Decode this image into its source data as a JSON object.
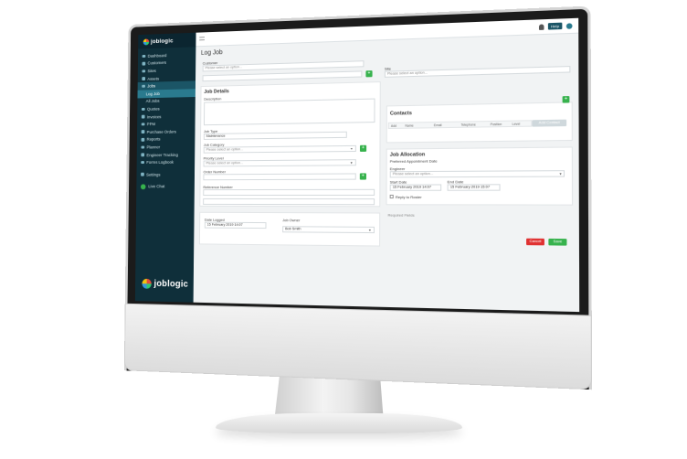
{
  "app": {
    "brand": "joblogic",
    "help_label": "Help"
  },
  "sidebar": {
    "items": [
      {
        "label": "Dashboard"
      },
      {
        "label": "Customers"
      },
      {
        "label": "Sites"
      },
      {
        "label": "Assets"
      },
      {
        "label": "Jobs"
      },
      {
        "label": "Log Job"
      },
      {
        "label": "All Jobs"
      },
      {
        "label": "Quotes"
      },
      {
        "label": "Invoices"
      },
      {
        "label": "PPM"
      },
      {
        "label": "Purchase Orders"
      },
      {
        "label": "Reports"
      },
      {
        "label": "Planner"
      },
      {
        "label": "Engineer Tracking"
      },
      {
        "label": "Forms Logbook"
      },
      {
        "label": "Settings"
      }
    ],
    "live_chat": "Live Chat"
  },
  "page": {
    "title": "Log Job"
  },
  "customer": {
    "label": "Customer",
    "placeholder": "Please select an option..."
  },
  "site": {
    "label": "Site",
    "placeholder": "Please select an option..."
  },
  "job_details": {
    "title": "Job Details",
    "description_label": "Description",
    "job_type_label": "Job Type",
    "job_type_value": "Maintenance",
    "job_category_label": "Job Category",
    "job_category_placeholder": "Please select an option...",
    "priority_label": "Priority Level",
    "priority_placeholder": "Please select an option...",
    "order_number_label": "Order Number",
    "reference_number_label": "Reference Number"
  },
  "contacts": {
    "title": "Contacts",
    "button": "Add Contact",
    "columns": [
      "Add",
      "Name",
      "Email",
      "Telephone",
      "Position",
      "Level"
    ]
  },
  "job_allocation": {
    "title": "Job Allocation",
    "preferred_label": "Preferred Appointment Date",
    "engineer_label": "Engineer",
    "engineer_placeholder": "Please select an option...",
    "start_date_label": "Start Date",
    "start_date_value": "15 February 2019 14:07",
    "end_date_label": "End Date",
    "end_date_value": "15 February 2019 15:07",
    "reply_label": "Reply to Roster",
    "required_note": "Required Fields"
  },
  "logging": {
    "date_logged_label": "Date Logged",
    "date_logged_value": "15 February 2019 14:07",
    "job_owner_label": "Job Owner",
    "job_owner_value": "Bob Smith"
  },
  "actions": {
    "cancel": "Cancel",
    "save": "Save"
  },
  "colors": {
    "sidebar": "#0f2f3a",
    "accent": "#37b24d",
    "danger": "#e03131",
    "active": "#1b5566"
  }
}
